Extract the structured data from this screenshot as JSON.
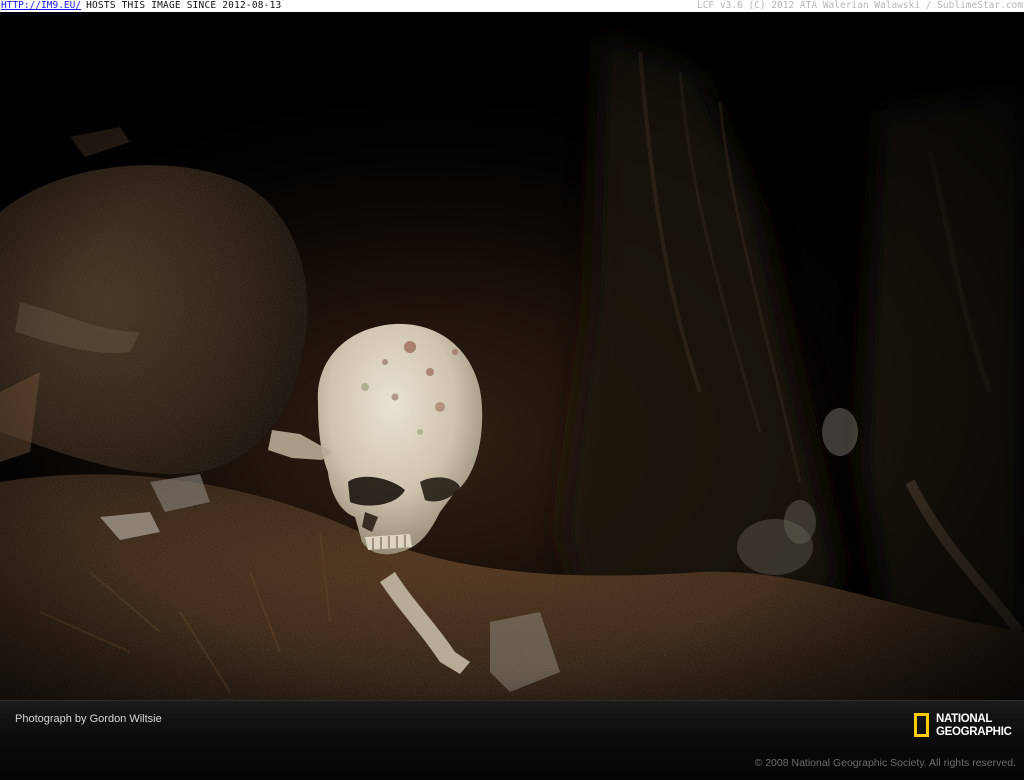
{
  "banner": {
    "host_link": "HTTP://IM9.EU/",
    "host_text": "HOSTS THIS IMAGE SINCE 2012-08-13",
    "version_text": "LCF v3.6 (C) 2012 ATA Walerian Walawski / SublimeStar.com"
  },
  "photo": {
    "subject": "human skull in dark cave among leaves and bones"
  },
  "caption": {
    "credit": "Photograph by Gordon Wiltsie",
    "logo_line1": "NATIONAL",
    "logo_line2": "GEOGRAPHIC",
    "copyright": "© 2008 National Geographic Society. All rights reserved."
  },
  "colors": {
    "banner_bg": "#ffffff",
    "link_blue": "#1a1aff",
    "logo_yellow": "#ffcc00",
    "caption_text": "#d8d8d8",
    "copyright_text": "#6d6d6d"
  }
}
